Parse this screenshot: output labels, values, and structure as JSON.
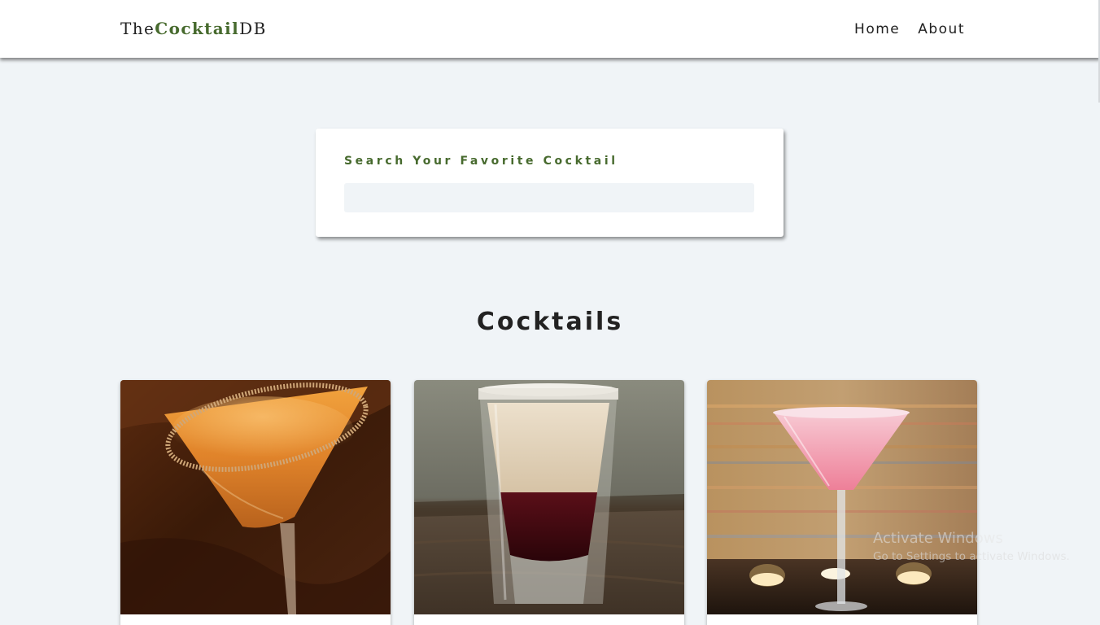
{
  "navbar": {
    "logo": {
      "prefix": "The",
      "accent": "Cocktail",
      "suffix": "DB"
    },
    "links": [
      "Home",
      "About"
    ]
  },
  "search": {
    "label": "Search Your Favorite Cocktail",
    "value": "",
    "placeholder": ""
  },
  "section": {
    "title": "Cocktails"
  },
  "colors": {
    "brand_green": "#476a2e",
    "background": "#f0f4f7",
    "surface": "#ffffff"
  },
  "cocktails": [
    {
      "image_icon": "orange-martini-glass-with-sugar-rim"
    },
    {
      "image_icon": "cream-and-berry-layered-shot-glass"
    },
    {
      "image_icon": "pink-martini-glass-with-candles"
    }
  ],
  "watermark": {
    "title": "Activate Windows",
    "subtitle": "Go to Settings to activate Windows."
  }
}
